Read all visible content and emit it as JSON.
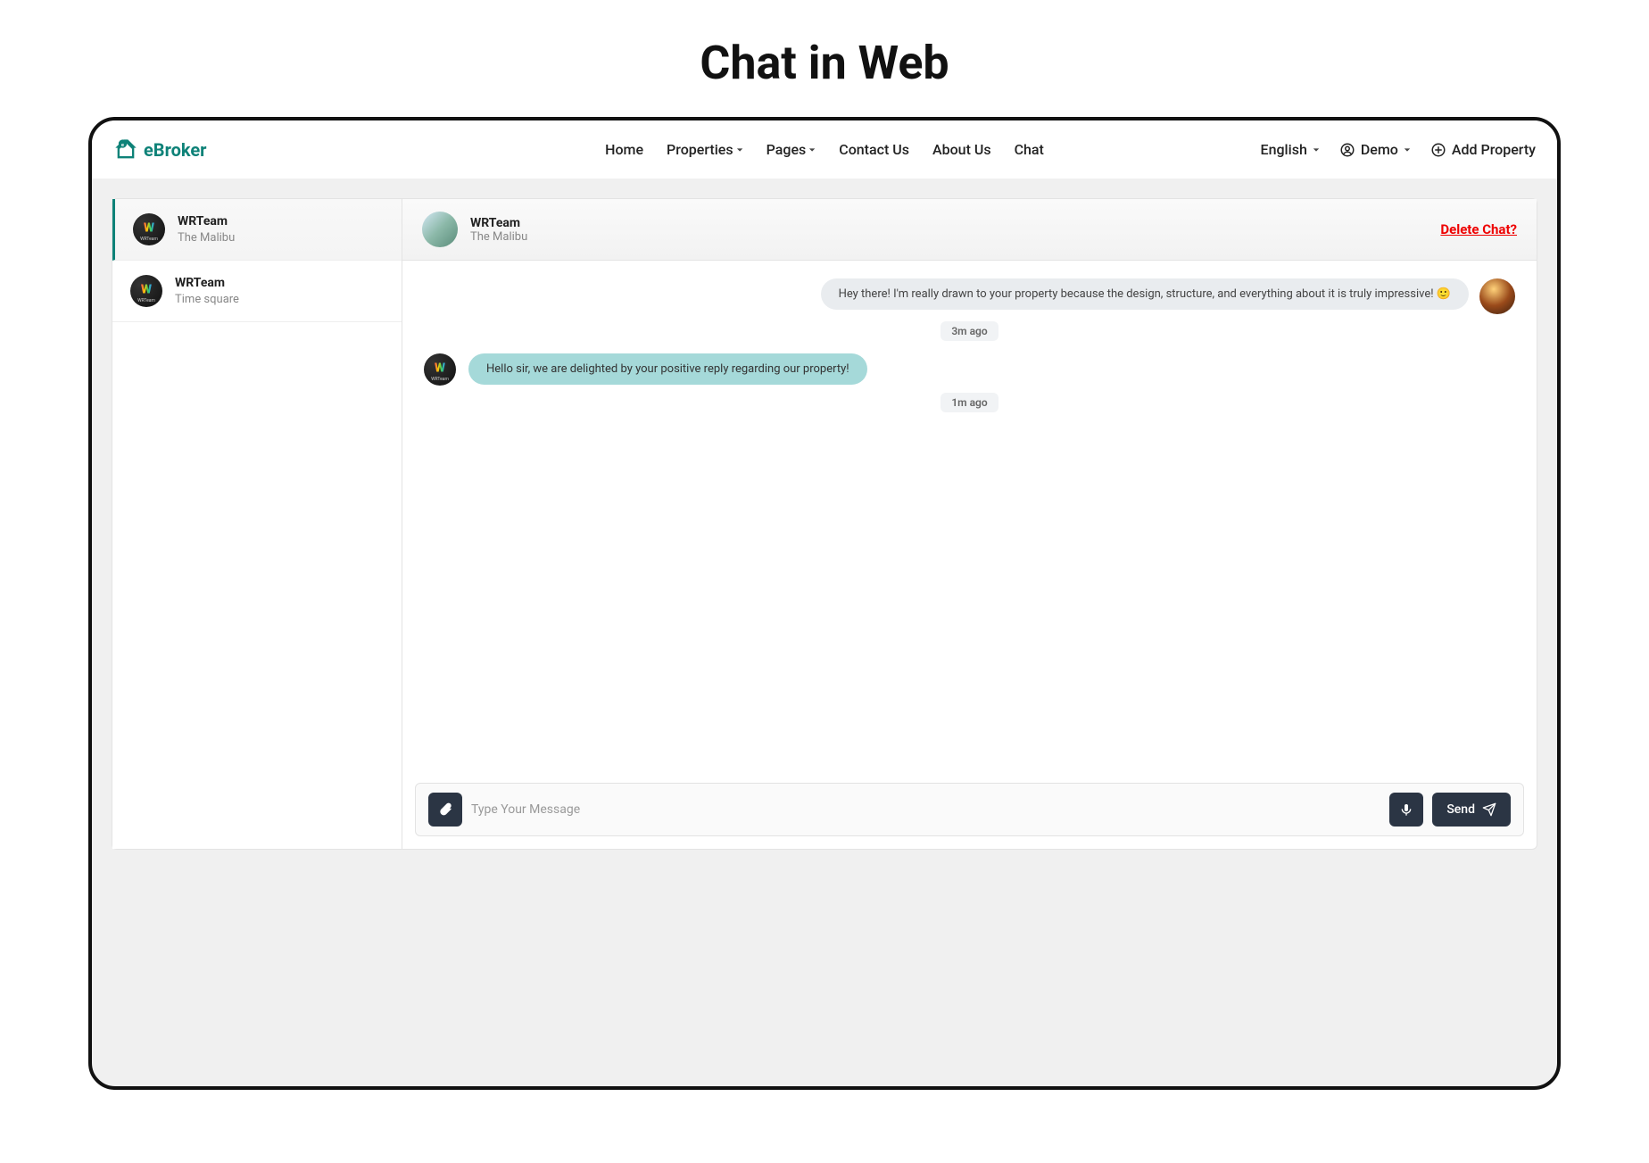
{
  "page": {
    "title": "Chat in Web"
  },
  "brand": {
    "name": "eBroker"
  },
  "nav": {
    "home": "Home",
    "properties": "Properties",
    "pages": "Pages",
    "contact": "Contact Us",
    "about": "About Us",
    "chat": "Chat"
  },
  "navRight": {
    "language": "English",
    "user": "Demo",
    "addProperty": "Add Property"
  },
  "sidebar": {
    "items": [
      {
        "name": "WRTeam",
        "property": "The Malibu"
      },
      {
        "name": "WRTeam",
        "property": "Time square"
      }
    ]
  },
  "chatHeader": {
    "name": "WRTeam",
    "property": "The Malibu",
    "deleteLabel": "Delete Chat?"
  },
  "messages": {
    "m1": "Hey there! I'm really drawn to your property because the design, structure, and everything about it is truly impressive! 🙂",
    "t1": "3m ago",
    "m2": "Hello sir, we are delighted by your positive reply regarding our property!",
    "t2": "1m ago"
  },
  "input": {
    "placeholder": "Type Your Message",
    "sendLabel": "Send"
  }
}
